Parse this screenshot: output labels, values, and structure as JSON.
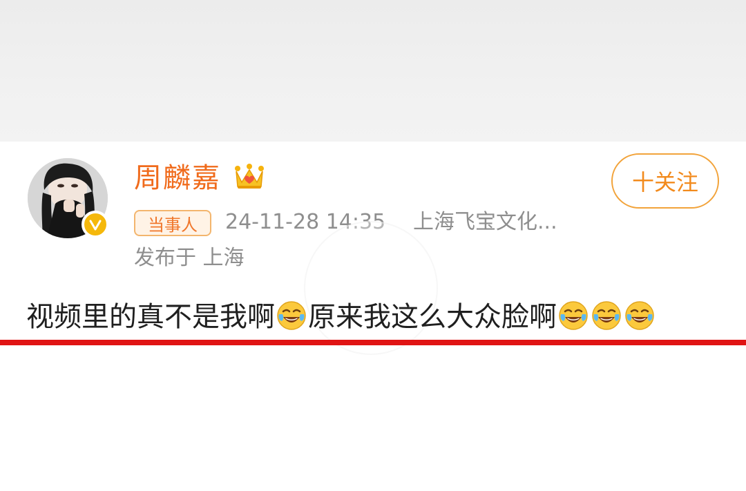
{
  "user": {
    "name": "周麟嘉",
    "avatar_icon": "user-avatar",
    "verified_icon": "verified-icon",
    "crown_icon": "crown-icon"
  },
  "follow_button": {
    "label": "十关注"
  },
  "meta": {
    "tag": "当事人",
    "time": "24-11-28 14:35",
    "source": "上海飞宝文化...",
    "location": "发布于 上海"
  },
  "post": {
    "text_part1": "视频里的真不是我啊",
    "text_part2": "原来我这么大众脸啊",
    "emoji_icons": [
      "crying-laughing-emoji",
      "crying-laughing-emoji",
      "crying-laughing-emoji",
      "crying-laughing-emoji"
    ]
  },
  "colors": {
    "accent_orange": "#f06b1c",
    "follow_border": "#f2a33a",
    "underline_red": "#e01414"
  }
}
